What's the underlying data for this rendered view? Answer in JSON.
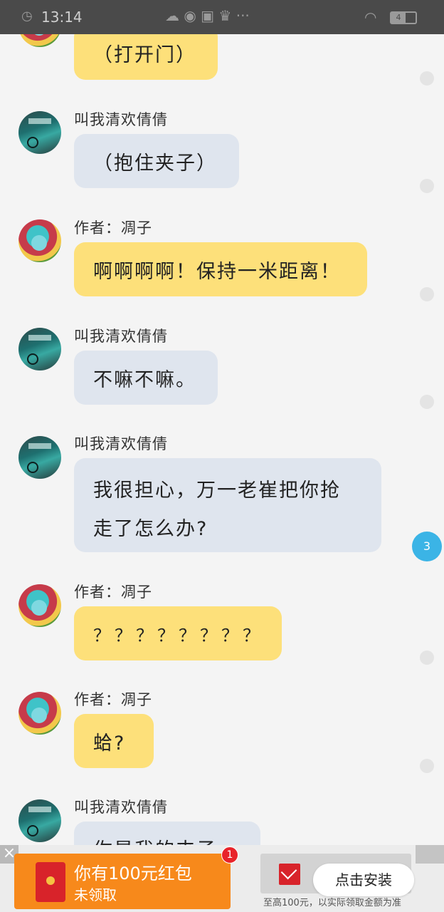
{
  "status_bar": {
    "time": "13:14",
    "battery": "4"
  },
  "messages": [
    {
      "role": "author",
      "name": "",
      "text": "（打开门）"
    },
    {
      "role": "friend",
      "name": "叫我清欢倩倩",
      "text": "（抱住夹子）"
    },
    {
      "role": "author",
      "name": "作者：凋子",
      "text": "啊啊啊啊！保持一米距离！"
    },
    {
      "role": "friend",
      "name": "叫我清欢倩倩",
      "text": "不嘛不嘛。"
    },
    {
      "role": "friend",
      "name": "叫我清欢倩倩",
      "line1": "我很担心，万一老崔把你抢",
      "line2": "走了怎么办?"
    },
    {
      "role": "author",
      "name": "作者：凋子",
      "text": "？？？？？？？？"
    },
    {
      "role": "author",
      "name": "作者：凋子",
      "text": "蛤?"
    },
    {
      "role": "friend",
      "name": "叫我清欢倩倩",
      "text": "你是我的夹子"
    }
  ],
  "unread_count": "3",
  "ad": {
    "close": "×",
    "promo_title": "你有100元红包",
    "promo_sub": "未领取",
    "badge": "1",
    "install_label": "点击安装",
    "note": "至高100元，以实际领取金额为准"
  },
  "colors": {
    "author_bubble": "#fde07a",
    "friend_bubble": "#dfe5ee",
    "badge_blue": "#3bb4e6"
  }
}
